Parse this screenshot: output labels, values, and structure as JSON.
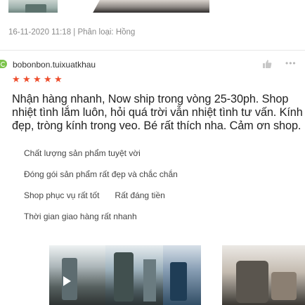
{
  "meta": {
    "date_variant": "16-11-2020 11:18 | Phân loại: Hồng"
  },
  "review": {
    "username": "bobonbon.tuixuatkhau",
    "rating": 5,
    "text": "Nhận hàng nhanh, Now ship trong vòng 25-30ph. Shop nhiệt tình lắm luôn, hỏi quá trời vẫn nhiệt tình tư vấn. Kính đẹp, tròng kính trong veo. Bé rất thích nha. Cảm ơn shop.",
    "tags": [
      [
        "Chất lượng sản phẩm tuyệt vời"
      ],
      [
        "Đóng gói sản phẩm rất đẹp và chắc chắn"
      ],
      [
        "Shop phục vụ rất tốt",
        "Rất đáng tiền"
      ],
      [
        "Thời gian giao hàng rất nhanh"
      ]
    ]
  },
  "icons": {
    "like": "thumbs-up-icon",
    "more": "more-icon",
    "star": "star-icon",
    "play": "play-icon"
  },
  "colors": {
    "star": "#ee4d2d",
    "meta": "#8a8a8a",
    "avatar": "#7cc44c"
  }
}
